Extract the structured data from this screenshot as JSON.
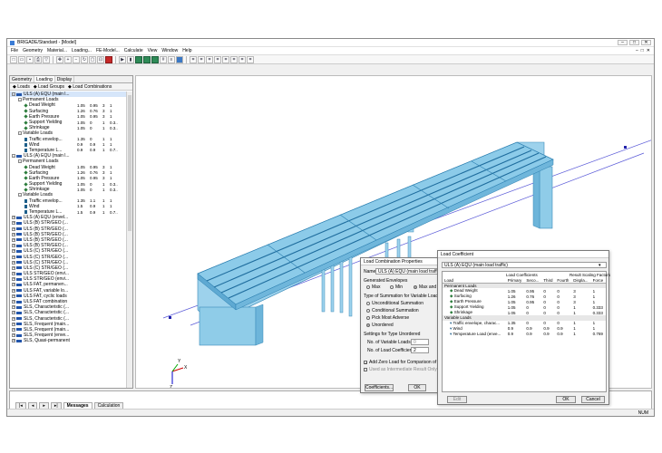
{
  "window": {
    "title": "BRIGADE/Standard - [Model]"
  },
  "menu": [
    "File",
    "Geometry",
    "Material...",
    "Loading...",
    "FE-Model...",
    "Calculate",
    "View",
    "Window",
    "Help"
  ],
  "left": {
    "tabs": [
      "Geometry",
      "Loading",
      "Display"
    ],
    "subtabs": [
      "Loads",
      "Load Groups",
      "Load Combinations"
    ]
  },
  "tree": [
    {
      "lvl": 0,
      "t": "comb",
      "exp": "-",
      "label": "ULS (A) EQU (main l...",
      "sel": true
    },
    {
      "lvl": 1,
      "t": "none",
      "exp": "-",
      "label": "Permanent Loads"
    },
    {
      "lvl": 2,
      "t": "dot",
      "label": "Dead Weight",
      "c": [
        "1.05",
        "0.95",
        "3",
        "1"
      ]
    },
    {
      "lvl": 2,
      "t": "dot",
      "label": "Surfacing",
      "c": [
        "1.26",
        "0.76",
        "3",
        "1"
      ]
    },
    {
      "lvl": 2,
      "t": "dot",
      "label": "Earth Pressure",
      "c": [
        "1.05",
        "0.95",
        "3",
        "1"
      ]
    },
    {
      "lvl": 2,
      "t": "dot",
      "label": "Support Yielding",
      "c": [
        "1.05",
        "0",
        "1",
        "0.3.."
      ]
    },
    {
      "lvl": 2,
      "t": "dot",
      "label": "Shrinkage",
      "c": [
        "1.05",
        "0",
        "1",
        "0.3.."
      ]
    },
    {
      "lvl": 1,
      "t": "none",
      "exp": "-",
      "label": "Variable Loads"
    },
    {
      "lvl": 2,
      "t": "var",
      "label": "Traffic envelop...",
      "c": [
        "1.35",
        "0",
        "1",
        "1"
      ]
    },
    {
      "lvl": 2,
      "t": "var",
      "label": "Wind",
      "c": [
        "0.9",
        "0.9",
        "1",
        "1"
      ]
    },
    {
      "lvl": 2,
      "t": "var",
      "label": "Temperature L...",
      "c": [
        "0.9",
        "0.9",
        "1",
        "0.7.."
      ]
    },
    {
      "lvl": 0,
      "t": "comb",
      "exp": "-",
      "label": "ULS (A) EQU (main l..."
    },
    {
      "lvl": 1,
      "t": "none",
      "exp": "-",
      "label": "Permanent Loads"
    },
    {
      "lvl": 2,
      "t": "dot",
      "label": "Dead Weight",
      "c": [
        "1.05",
        "0.95",
        "3",
        "1"
      ]
    },
    {
      "lvl": 2,
      "t": "dot",
      "label": "Surfacing",
      "c": [
        "1.26",
        "0.76",
        "3",
        "1"
      ]
    },
    {
      "lvl": 2,
      "t": "dot",
      "label": "Earth Pressure",
      "c": [
        "1.05",
        "0.95",
        "3",
        "1"
      ]
    },
    {
      "lvl": 2,
      "t": "dot",
      "label": "Support Yielding",
      "c": [
        "1.05",
        "0",
        "1",
        "0.3.."
      ]
    },
    {
      "lvl": 2,
      "t": "dot",
      "label": "Shrinkage",
      "c": [
        "1.05",
        "0",
        "1",
        "0.3.."
      ]
    },
    {
      "lvl": 1,
      "t": "none",
      "exp": "-",
      "label": "Variable Loads"
    },
    {
      "lvl": 2,
      "t": "var",
      "label": "Traffic envelop...",
      "c": [
        "1.35",
        "1.1",
        "1",
        "1"
      ]
    },
    {
      "lvl": 2,
      "t": "var",
      "label": "Wind",
      "c": [
        "1.5",
        "0.9",
        "1",
        "1"
      ]
    },
    {
      "lvl": 2,
      "t": "var",
      "label": "Temperature L...",
      "c": [
        "1.5",
        "0.9",
        "1",
        "0.7.."
      ]
    },
    {
      "lvl": 0,
      "t": "comb",
      "exp": "+",
      "label": "ULS (A) EQU (envel..."
    },
    {
      "lvl": 0,
      "t": "comb",
      "exp": "+",
      "label": "ULS (B) STR/GEO (..."
    },
    {
      "lvl": 0,
      "t": "comb",
      "exp": "+",
      "label": "ULS (B) STR/GEO (..."
    },
    {
      "lvl": 0,
      "t": "comb",
      "exp": "+",
      "label": "ULS (B) STR/GEO (..."
    },
    {
      "lvl": 0,
      "t": "comb",
      "exp": "+",
      "label": "ULS (B) STR/GEO (..."
    },
    {
      "lvl": 0,
      "t": "comb",
      "exp": "+",
      "label": "ULS (B) STR/GEO (..."
    },
    {
      "lvl": 0,
      "t": "comb",
      "exp": "+",
      "label": "ULS (C) STR/GEO (..."
    },
    {
      "lvl": 0,
      "t": "comb",
      "exp": "+",
      "label": "ULS (C) STR/GEO (..."
    },
    {
      "lvl": 0,
      "t": "comb",
      "exp": "+",
      "label": "ULS (C) STR/GEO (..."
    },
    {
      "lvl": 0,
      "t": "comb",
      "exp": "+",
      "label": "ULS (C) STR/GEO (..."
    },
    {
      "lvl": 0,
      "t": "comb",
      "exp": "+",
      "label": "ULS STR/GEO (envi..."
    },
    {
      "lvl": 0,
      "t": "comb",
      "exp": "+",
      "label": "ULS STR/GEO (envi..."
    },
    {
      "lvl": 0,
      "t": "comb",
      "exp": "+",
      "label": "ULS FAT, permanen..."
    },
    {
      "lvl": 0,
      "t": "comb",
      "exp": "+",
      "label": "ULS FAT, variable lo..."
    },
    {
      "lvl": 0,
      "t": "comb",
      "exp": "+",
      "label": "ULS FAT, cyclic loads"
    },
    {
      "lvl": 0,
      "t": "comb",
      "exp": "+",
      "label": "ULS FAT combination"
    },
    {
      "lvl": 0,
      "t": "comb",
      "exp": "+",
      "label": "SLS, Characteristic (..."
    },
    {
      "lvl": 0,
      "t": "comb",
      "exp": "+",
      "label": "SLS, Characteristic (..."
    },
    {
      "lvl": 0,
      "t": "comb",
      "exp": "+",
      "label": "SLS, Characteristic (..."
    },
    {
      "lvl": 0,
      "t": "comb",
      "exp": "+",
      "label": "SLS, Frequent (main..."
    },
    {
      "lvl": 0,
      "t": "comb",
      "exp": "+",
      "label": "SLS, Frequent (main..."
    },
    {
      "lvl": 0,
      "t": "comb",
      "exp": "+",
      "label": "SLS, Frequent (enve..."
    },
    {
      "lvl": 0,
      "t": "comb",
      "exp": "+",
      "label": "SLS, Quasi-permanent"
    }
  ],
  "messages": {
    "tabs": [
      "Messages",
      "Calculation"
    ]
  },
  "status": {
    "num": "NUM"
  },
  "lcp": {
    "title": "Load Combination Properties",
    "name_label": "Name",
    "name_value": "ULS (A) EQU (main load traffic)",
    "gen_env": "Generated Envelopes",
    "max": "Max",
    "min": "Min",
    "maxmin": "Max and Min",
    "sum_type": "Type of Summation for Variable Loads",
    "opts": [
      "Unconditional Summation",
      "Conditional Summation",
      "Pick Most Adverse",
      "Unordered"
    ],
    "settings": "Settings for Type Unordered",
    "nvar_label": "No. of Variable Loads",
    "nvar": "0",
    "ncoef_label": "No. of Load Coefficients",
    "ncoef": "2",
    "zero": "Add Zero Load for Comparison of Variable",
    "inter": "Used as Intermediate Result Only",
    "coef_btn": "Coefficients...",
    "ok": "OK"
  },
  "lc": {
    "title": "Load Coefficient",
    "combo": "ULS (A) EQU (main load traffic)",
    "hdr1": "Load Coefficients",
    "hdr2": "Result Scaling Factors",
    "cols": [
      "Load",
      "Primary",
      "Seco...",
      "Third",
      "Fourth",
      "Displa...",
      "Force"
    ],
    "rows": [
      {
        "cat": true,
        "c": [
          "Permanent Loads",
          "",
          "",
          "",
          "",
          "",
          ""
        ]
      },
      {
        "c": [
          "Dead Weight",
          "1.05",
          "0.95",
          "0",
          "0",
          "3",
          "1"
        ]
      },
      {
        "c": [
          "Surfacing",
          "1.26",
          "0.76",
          "0",
          "0",
          "3",
          "1"
        ]
      },
      {
        "c": [
          "Earth Pressure",
          "1.05",
          "0.95",
          "0",
          "0",
          "3",
          "1"
        ]
      },
      {
        "c": [
          "Support Yielding",
          "1.05",
          "0",
          "0",
          "0",
          "1",
          "0.333"
        ]
      },
      {
        "c": [
          "Shrinkage",
          "1.05",
          "0",
          "0",
          "0",
          "1",
          "0.333"
        ]
      },
      {
        "cat": true,
        "c": [
          "Variable Loads",
          "",
          "",
          "",
          "",
          "",
          ""
        ]
      },
      {
        "c": [
          "Traffic envelope, charac...",
          "1.35",
          "0",
          "0",
          "0",
          "1",
          "1"
        ]
      },
      {
        "c": [
          "Wind",
          "0.9",
          "0.9",
          "0.9",
          "0.9",
          "1",
          "1"
        ]
      },
      {
        "c": [
          "Temperature Load (enve...",
          "0.9",
          "0.9",
          "0.9",
          "0.9",
          "1",
          "0.769"
        ]
      }
    ],
    "edit": "Edit",
    "ok": "OK",
    "cancel": "Cancel"
  },
  "axes": {
    "x": "X",
    "y": "Y",
    "z": "Z"
  }
}
